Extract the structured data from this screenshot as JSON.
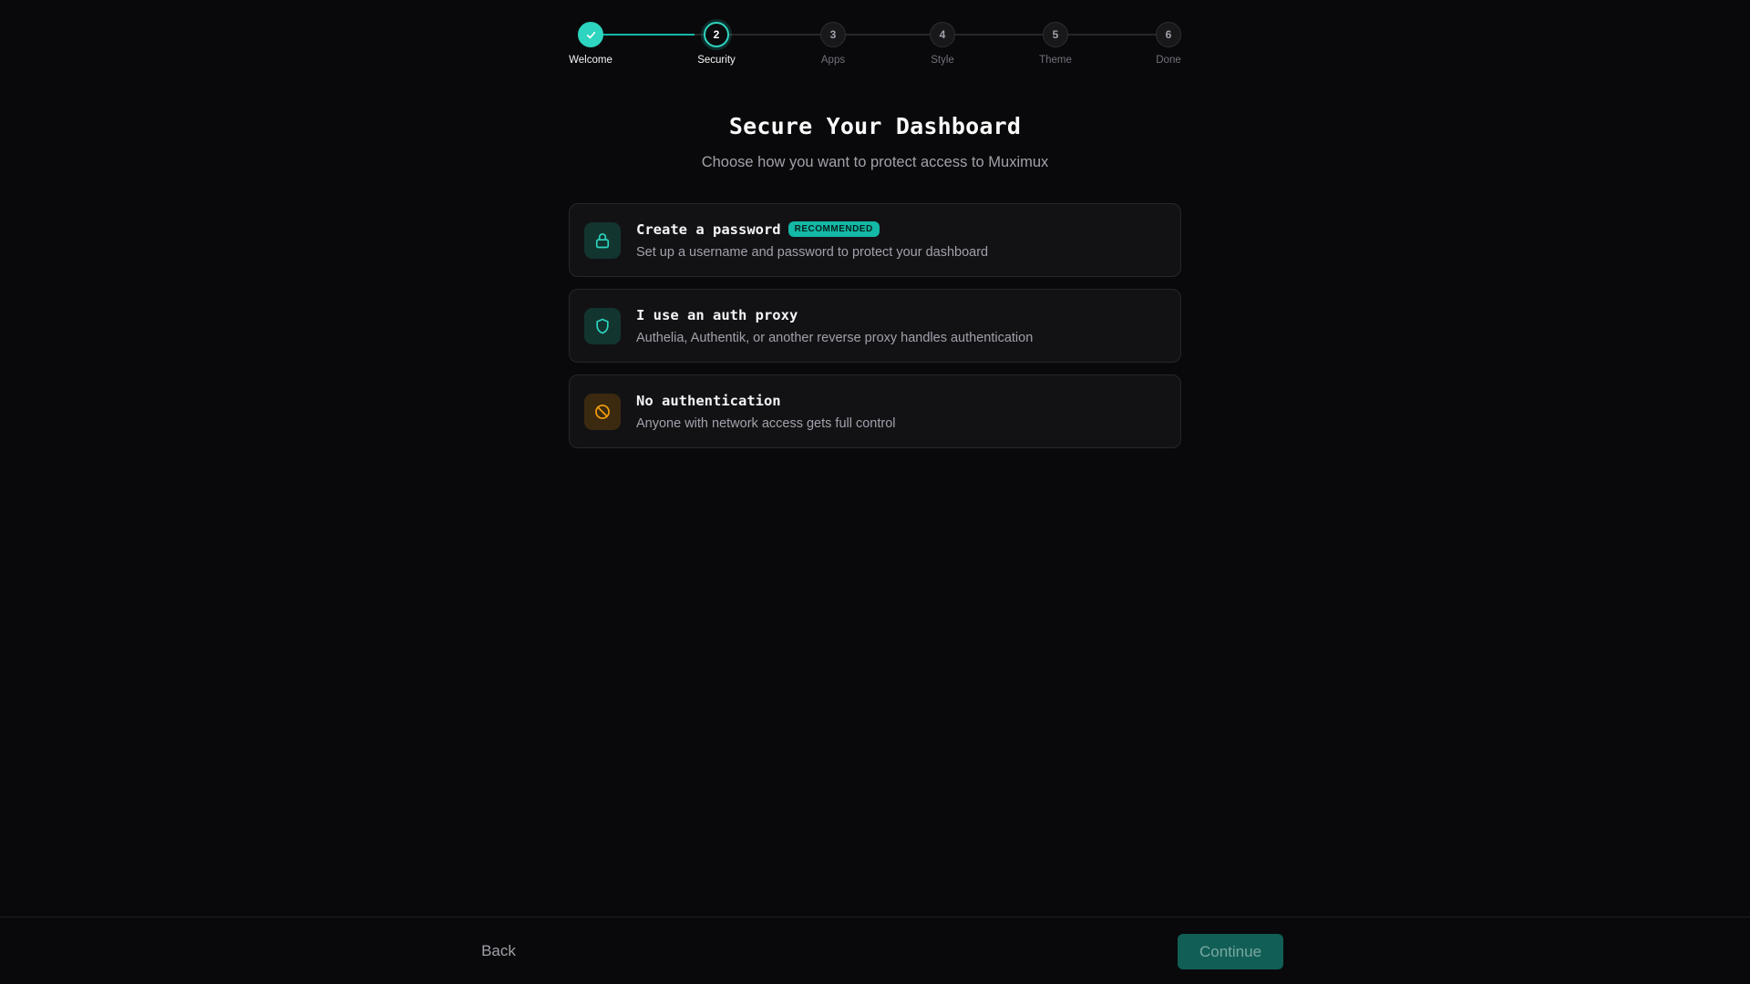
{
  "stepper": {
    "steps": [
      {
        "number": "",
        "label": "Welcome",
        "state": "complete"
      },
      {
        "number": "2",
        "label": "Security",
        "state": "current"
      },
      {
        "number": "3",
        "label": "Apps",
        "state": "upcoming"
      },
      {
        "number": "4",
        "label": "Style",
        "state": "upcoming"
      },
      {
        "number": "5",
        "label": "Theme",
        "state": "upcoming"
      },
      {
        "number": "6",
        "label": "Done",
        "state": "upcoming"
      }
    ]
  },
  "header": {
    "title": "Secure Your Dashboard",
    "subtitle": "Choose how you want to protect access to Muximux"
  },
  "options": [
    {
      "icon": "lock-icon",
      "title": "Create a password",
      "badge": "RECOMMENDED",
      "description": "Set up a username and password to protect your dashboard"
    },
    {
      "icon": "shield-icon",
      "title": "I use an auth proxy",
      "description": "Authelia, Authentik, or another reverse proxy handles authentication"
    },
    {
      "icon": "no-entry-icon",
      "title": "No authentication",
      "description": "Anyone with network access gets full control"
    }
  ],
  "footer": {
    "back_label": "Back",
    "continue_label": "Continue"
  },
  "colors": {
    "accent": "#2dd4bf",
    "accent_dark": "#14b8a6",
    "warning": "#f59e0b",
    "background": "#09090b",
    "card": "#121215"
  }
}
